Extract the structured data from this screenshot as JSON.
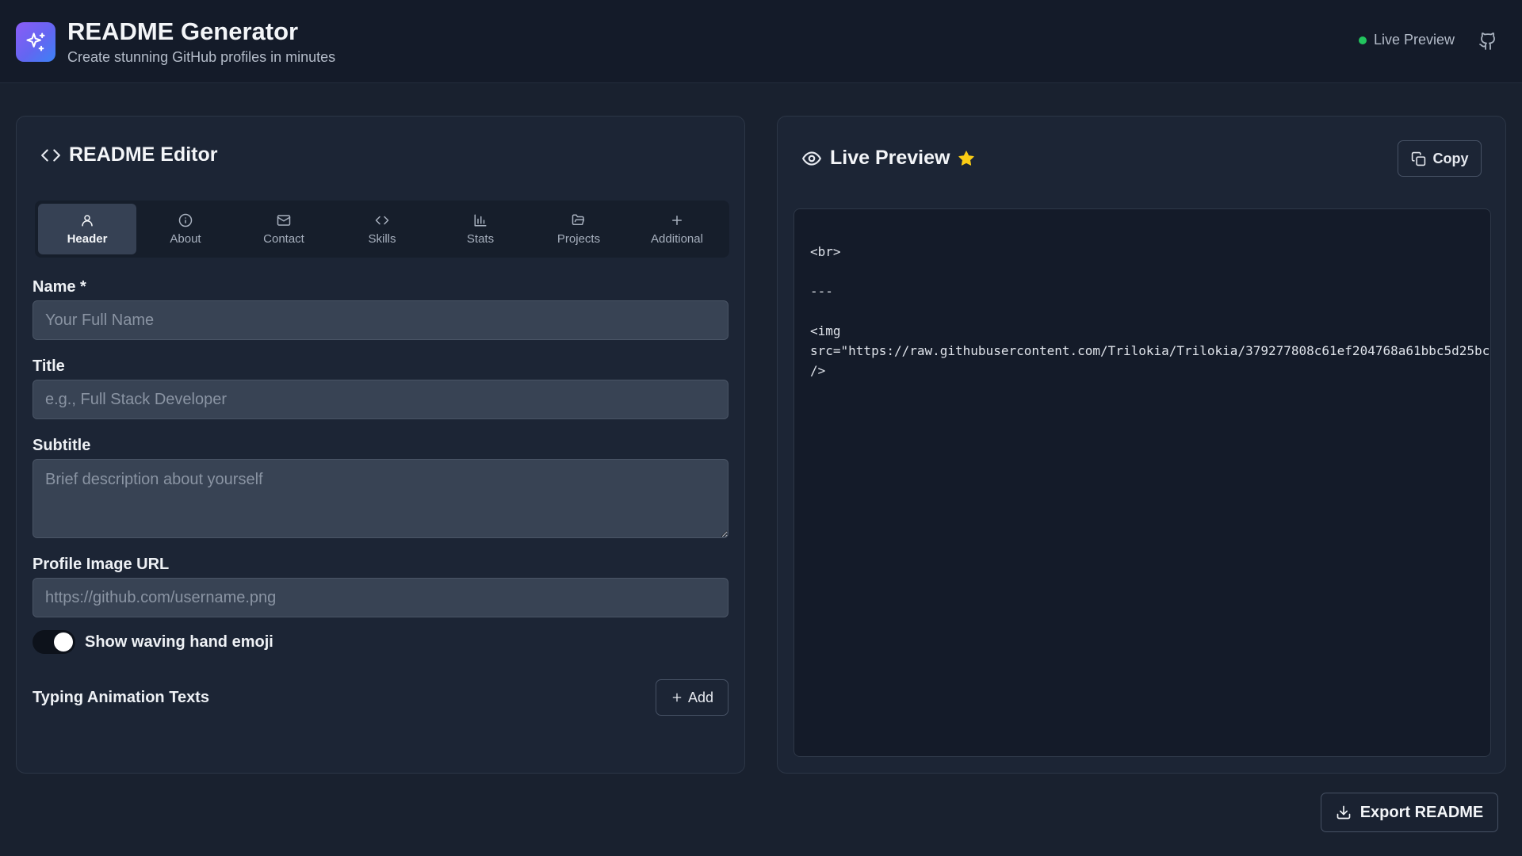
{
  "header": {
    "title": "README Generator",
    "subtitle": "Create stunning GitHub profiles in minutes",
    "live_status": "Live Preview",
    "logo_icon": "sparkles-icon",
    "github_icon": "github-icon"
  },
  "editor": {
    "heading": "README Editor",
    "tabs": [
      {
        "label": "Header",
        "icon": "user-icon",
        "active": true
      },
      {
        "label": "About",
        "icon": "info-icon",
        "active": false
      },
      {
        "label": "Contact",
        "icon": "mail-icon",
        "active": false
      },
      {
        "label": "Skills",
        "icon": "code-icon",
        "active": false
      },
      {
        "label": "Stats",
        "icon": "bar-chart-icon",
        "active": false
      },
      {
        "label": "Projects",
        "icon": "folder-icon",
        "active": false
      },
      {
        "label": "Additional",
        "icon": "plus-icon",
        "active": false
      }
    ],
    "fields": {
      "name": {
        "label": "Name *",
        "value": "",
        "placeholder": "Your Full Name"
      },
      "title": {
        "label": "Title",
        "value": "",
        "placeholder": "e.g., Full Stack Developer"
      },
      "subtitle": {
        "label": "Subtitle",
        "value": "",
        "placeholder": "Brief description about yourself"
      },
      "profile_image": {
        "label": "Profile Image URL",
        "value": "",
        "placeholder": "https://github.com/username.png"
      }
    },
    "wave_toggle": {
      "label": "Show waving hand emoji",
      "on": true
    },
    "typing": {
      "label": "Typing Animation Texts",
      "add_label": "Add"
    }
  },
  "preview": {
    "heading": "Live Preview",
    "copy_label": "Copy",
    "code_lines": [
      "<br>",
      "---",
      "<img",
      "src=\"https://raw.githubusercontent.com/Trilokia/Trilokia/379277808c61ef204768a61bbc5d25bc",
      "/>"
    ]
  },
  "export_label": "Export README",
  "colors": {
    "accent_gradient_start": "#8b5cf6",
    "accent_gradient_end": "#3b82f6",
    "status_green": "#22c55e",
    "star_yellow": "#facc15"
  }
}
